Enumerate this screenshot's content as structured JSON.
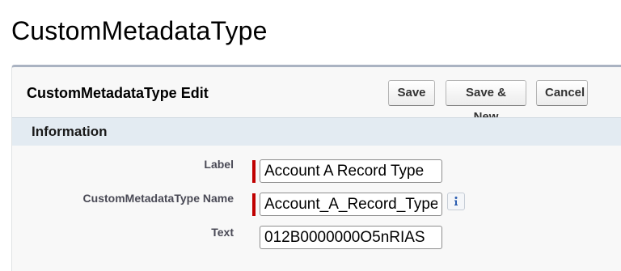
{
  "page": {
    "title": "CustomMetadataType"
  },
  "panel": {
    "title": "CustomMetadataType Edit",
    "buttons": {
      "save": "Save",
      "save_new": "Save & New",
      "cancel": "Cancel"
    }
  },
  "section": {
    "title": "Information"
  },
  "form": {
    "label": {
      "label": "Label",
      "value": "Account A Record Type",
      "required": true
    },
    "name": {
      "label": "CustomMetadataType Name",
      "value": "Account_A_Record_Type",
      "required": true,
      "help_icon": "info-icon"
    },
    "text": {
      "label": "Text",
      "value": "012B0000000O5nRIAS",
      "required": false
    }
  },
  "colors": {
    "required_marker": "#c00000",
    "section_background": "#e3ebf2",
    "panel_border_top": "#aab3c2"
  }
}
